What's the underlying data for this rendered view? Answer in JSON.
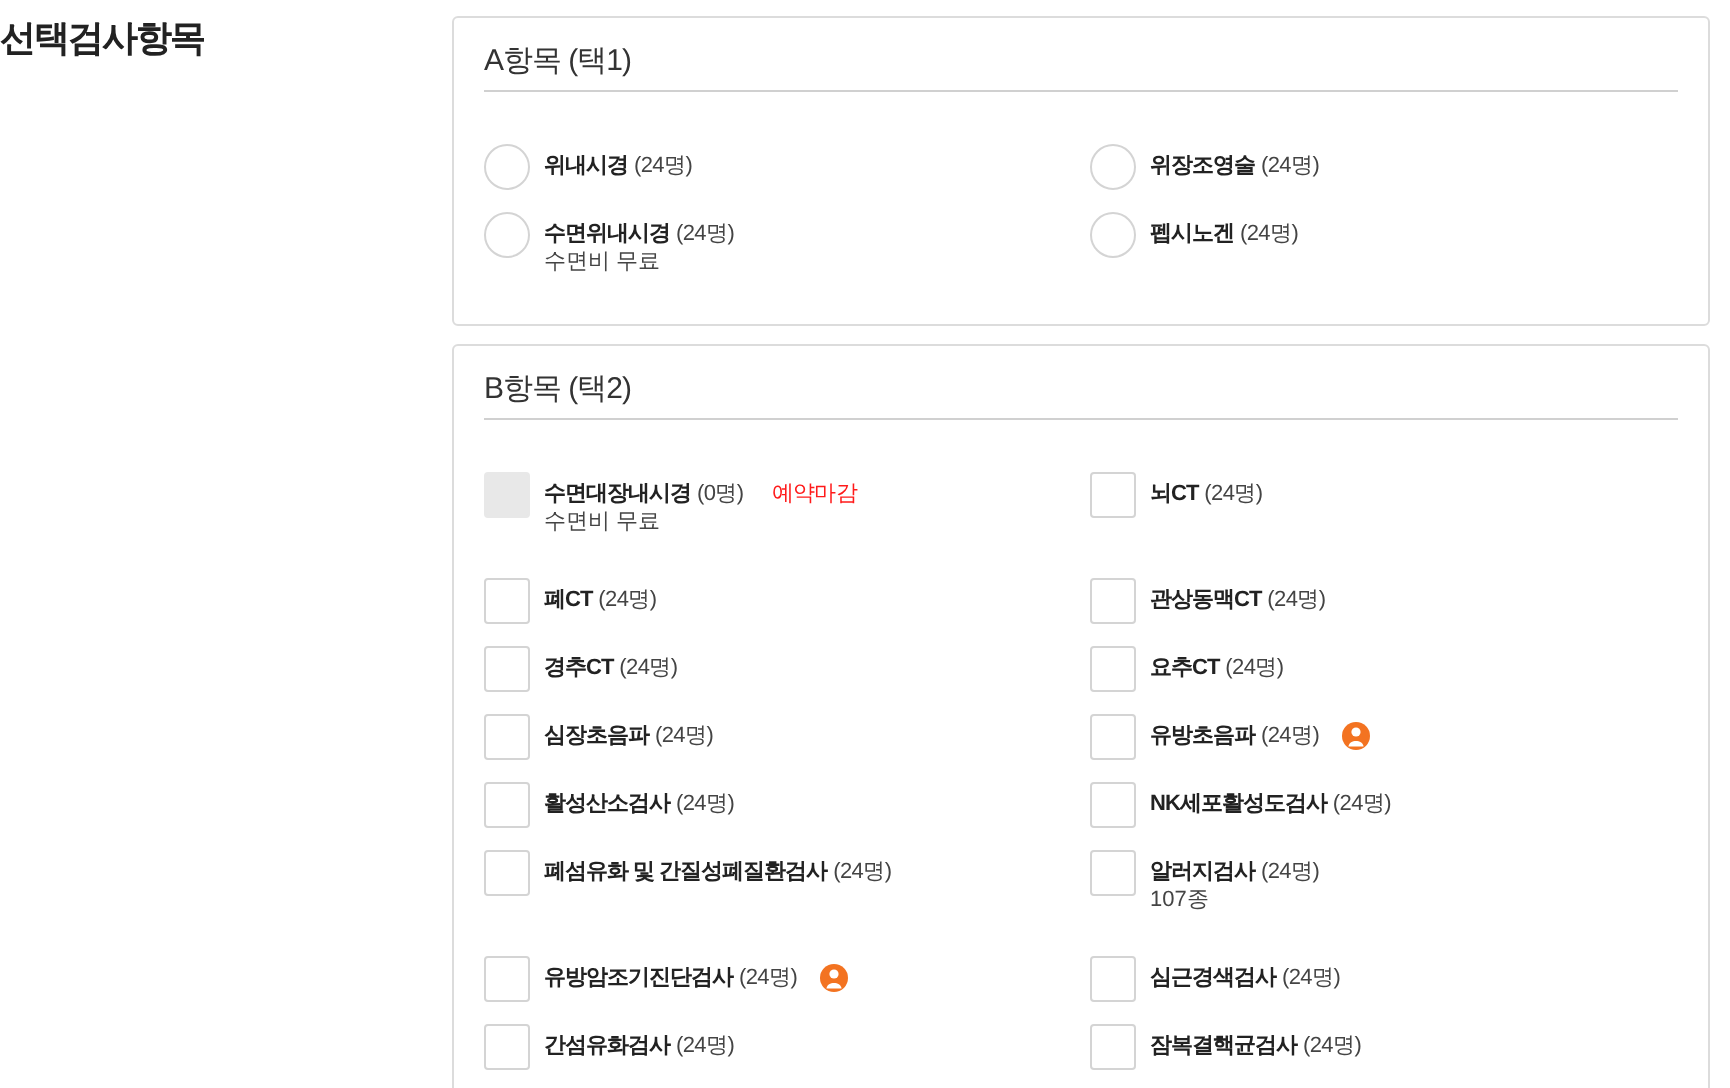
{
  "heading": "선택검사항목",
  "sections": [
    {
      "title": "A항목 (택1)",
      "kind": "radio",
      "items": [
        {
          "name": "위내시경",
          "count": "(24명)",
          "checked": false
        },
        {
          "name": "위장조영술",
          "count": "(24명)",
          "checked": false
        },
        {
          "name": "수면위내시경",
          "count": "(24명)",
          "sub": "수면비 무료",
          "checked": false
        },
        {
          "name": "펩시노겐",
          "count": "(24명)",
          "checked": false
        }
      ]
    },
    {
      "title": "B항목 (택2)",
      "kind": "checkbox",
      "items": [
        {
          "name": "수면대장내시경",
          "count": "(0명)",
          "note": "예약마감",
          "sub": "수면비 무료",
          "checked": false,
          "disabled": true
        },
        {
          "name": "뇌CT",
          "count": "(24명)",
          "checked": false,
          "disabled": false
        },
        {
          "name": "폐CT",
          "count": "(24명)",
          "checked": false,
          "disabled": false
        },
        {
          "name": "관상동맥CT",
          "count": "(24명)",
          "checked": false,
          "disabled": false
        },
        {
          "name": "경추CT",
          "count": "(24명)",
          "checked": false,
          "disabled": false
        },
        {
          "name": "요추CT",
          "count": "(24명)",
          "checked": false,
          "disabled": false
        },
        {
          "name": "심장초음파",
          "count": "(24명)",
          "checked": false,
          "disabled": false
        },
        {
          "name": "유방초음파",
          "count": "(24명)",
          "person_badge": true,
          "checked": false,
          "disabled": false
        },
        {
          "name": "활성산소검사",
          "count": "(24명)",
          "checked": false,
          "disabled": false
        },
        {
          "name": "NK세포활성도검사",
          "count": "(24명)",
          "checked": false,
          "disabled": false
        },
        {
          "name": "폐섬유화 및 간질성폐질환검사",
          "count": "(24명)",
          "checked": false,
          "disabled": false
        },
        {
          "name": "알러지검사",
          "count": "(24명)",
          "sub": "107종",
          "checked": false,
          "disabled": false
        },
        {
          "name": "유방암조기진단검사",
          "count": "(24명)",
          "person_badge": true,
          "checked": false,
          "disabled": false
        },
        {
          "name": "심근경색검사",
          "count": "(24명)",
          "checked": false,
          "disabled": false
        },
        {
          "name": "간섬유화검사",
          "count": "(24명)",
          "checked": false,
          "disabled": false
        },
        {
          "name": "잠복결핵균검사",
          "count": "(24명)",
          "checked": false,
          "disabled": false
        }
      ]
    }
  ]
}
